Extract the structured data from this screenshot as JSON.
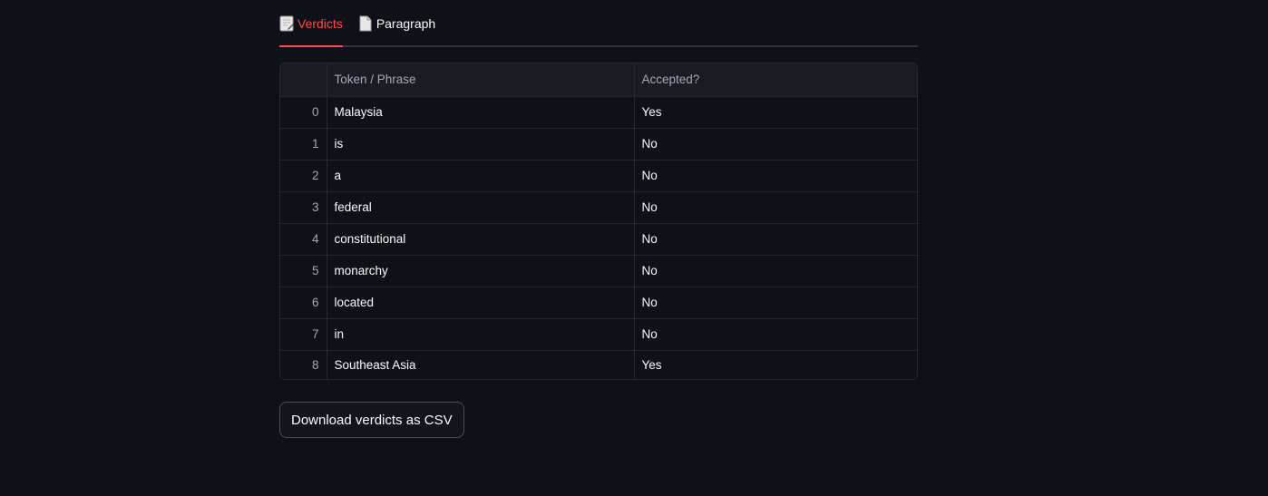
{
  "tabs": [
    {
      "label": "Verdicts",
      "icon": "memo-icon",
      "active": true
    },
    {
      "label": "Paragraph",
      "icon": "page-icon",
      "active": false
    }
  ],
  "table": {
    "headers": [
      "",
      "Token / Phrase",
      "Accepted?"
    ],
    "rows": [
      {
        "index": "0",
        "token": "Malaysia",
        "accepted": "Yes"
      },
      {
        "index": "1",
        "token": "is",
        "accepted": "No"
      },
      {
        "index": "2",
        "token": "a",
        "accepted": "No"
      },
      {
        "index": "3",
        "token": "federal",
        "accepted": "No"
      },
      {
        "index": "4",
        "token": "constitutional",
        "accepted": "No"
      },
      {
        "index": "5",
        "token": "monarchy",
        "accepted": "No"
      },
      {
        "index": "6",
        "token": "located",
        "accepted": "No"
      },
      {
        "index": "7",
        "token": "in",
        "accepted": "No"
      },
      {
        "index": "8",
        "token": "Southeast Asia",
        "accepted": "Yes"
      }
    ]
  },
  "download": {
    "label": "Download verdicts as CSV"
  },
  "colors": {
    "accent": "#ff4b4b",
    "background": "#0e1117"
  }
}
